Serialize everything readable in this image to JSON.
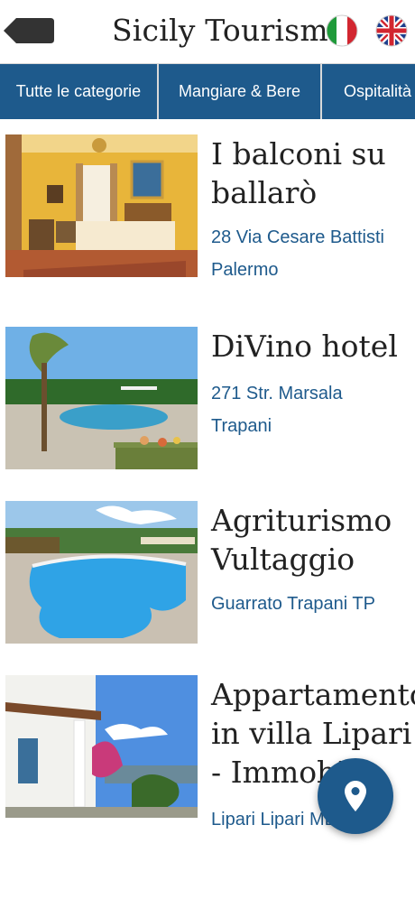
{
  "header": {
    "title": "Sicily Tourism",
    "back_icon": "back-arrow-icon",
    "flag_it": "italy-flag-icon",
    "flag_uk": "uk-flag-icon"
  },
  "tabs": [
    {
      "label": "Tutte le categorie"
    },
    {
      "label": "Mangiare & Bere"
    },
    {
      "label": "Ospitalità"
    }
  ],
  "items": [
    {
      "title": "I balconi su ballarò",
      "street": "28 Via Cesare Battisti",
      "city": "Palermo"
    },
    {
      "title": "DiVino hotel",
      "street": "271 Str. Marsala",
      "city": "Trapani"
    },
    {
      "title": "Agriturismo Vultaggio",
      "street": "Guarrato Trapani TP",
      "city": ""
    },
    {
      "title": "Appartamento in villa Lipari - Immobili...",
      "street": "Lipari Lipari ME",
      "city": ""
    }
  ],
  "fab": {
    "icon": "map-pin-icon"
  },
  "colors": {
    "brand": "#1e5a8c",
    "title_text": "#222222",
    "background": "#ffffff"
  }
}
